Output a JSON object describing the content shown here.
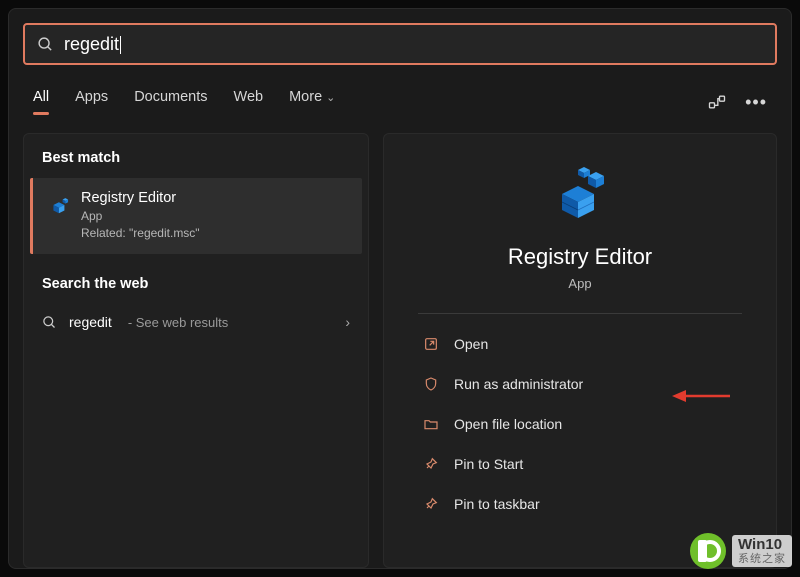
{
  "search": {
    "query": "regedit"
  },
  "tabs": {
    "all": "All",
    "apps": "Apps",
    "documents": "Documents",
    "web": "Web",
    "more": "More"
  },
  "left": {
    "best_match_heading": "Best match",
    "best": {
      "title": "Registry Editor",
      "subtitle": "App",
      "related": "Related: \"regedit.msc\""
    },
    "search_web_heading": "Search the web",
    "web_item": {
      "term": "regedit",
      "hint": "- See web results"
    }
  },
  "right": {
    "title": "Registry Editor",
    "subtitle": "App",
    "actions": {
      "open": "Open",
      "run_admin": "Run as administrator",
      "open_loc": "Open file location",
      "pin_start": "Pin to Start",
      "pin_taskbar": "Pin to taskbar"
    }
  },
  "watermark": {
    "line1": "Win10",
    "line2": "系统之家"
  }
}
